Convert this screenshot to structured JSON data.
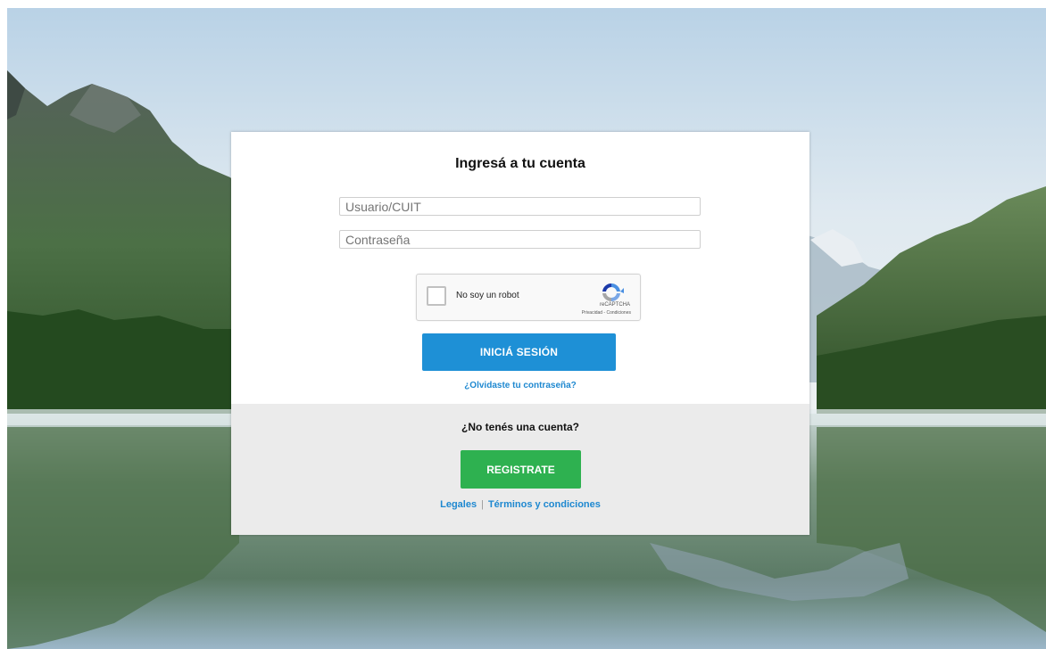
{
  "background": {
    "scene": "mountain-lake-reflection"
  },
  "login": {
    "title": "Ingresá a tu cuenta",
    "username_placeholder": "Usuario/CUIT",
    "password_placeholder": "Contraseña",
    "username_value": "",
    "password_value": "",
    "recaptcha": {
      "label": "No soy un robot",
      "brand": "reCAPTCHA",
      "links": "Privacidad - Condiciones",
      "icon": "recaptcha-logo"
    },
    "submit_label": "INICIÁ SESIÓN",
    "forgot_label": "¿Olvidaste tu contraseña?"
  },
  "register": {
    "prompt": "¿No tenés una cuenta?",
    "button_label": "REGISTRATE",
    "links": {
      "legal": "Legales",
      "separator": "|",
      "terms": "Términos y condiciones"
    }
  },
  "colors": {
    "primary_blue": "#1e90d6",
    "register_green": "#2eb150",
    "link_blue": "#1e88d0"
  }
}
